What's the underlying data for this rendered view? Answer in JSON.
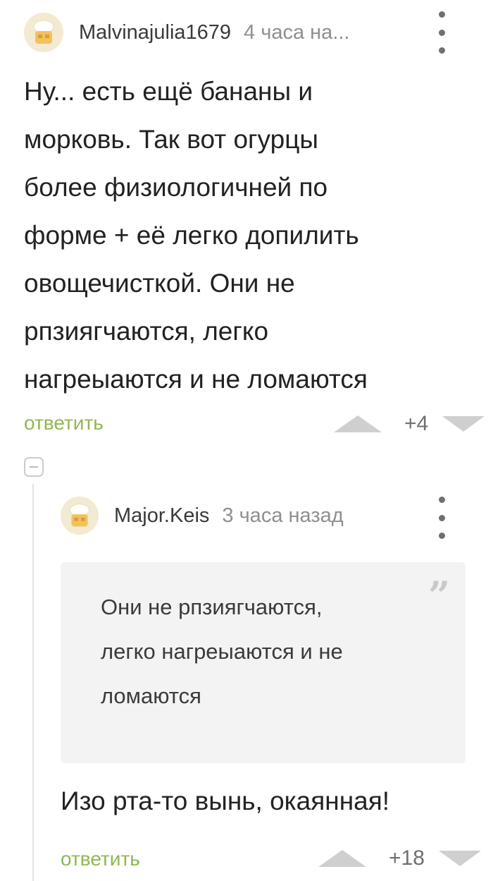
{
  "comments": [
    {
      "username": "Malvinajulia1679",
      "time": "4 часа на...",
      "text_lines": [
        "Ну... есть ещё бананы и",
        "морковь. Так вот огурцы",
        "более физиологичней по",
        "форме + её легко допилить",
        "овощечисткой. Они не",
        "рпзиягчаются, легко",
        "нагреыаются и не ломаются"
      ],
      "reply_label": "ответить",
      "score": "+4"
    },
    {
      "username": "Major.Keis",
      "time": "3 часа назад",
      "quote_lines": [
        "Они не рпзиягчаются,",
        "легко нагреыаются и не",
        "ломаются"
      ],
      "text": "Изо рта-то вынь, окаянная!",
      "reply_label": "ответить",
      "score": "+18"
    }
  ],
  "icons": {
    "avatar": "default-avatar-icon",
    "more": "more-vertical-icon",
    "upvote": "upvote-triangle-icon",
    "downvote": "downvote-triangle-icon",
    "collapse": "collapse-minus-icon",
    "quote": "quote-mark-icon"
  },
  "colors": {
    "reply": "#8fb851",
    "quote_background": "#f3f3f3",
    "vote_arrow": "#cfcfcf"
  }
}
